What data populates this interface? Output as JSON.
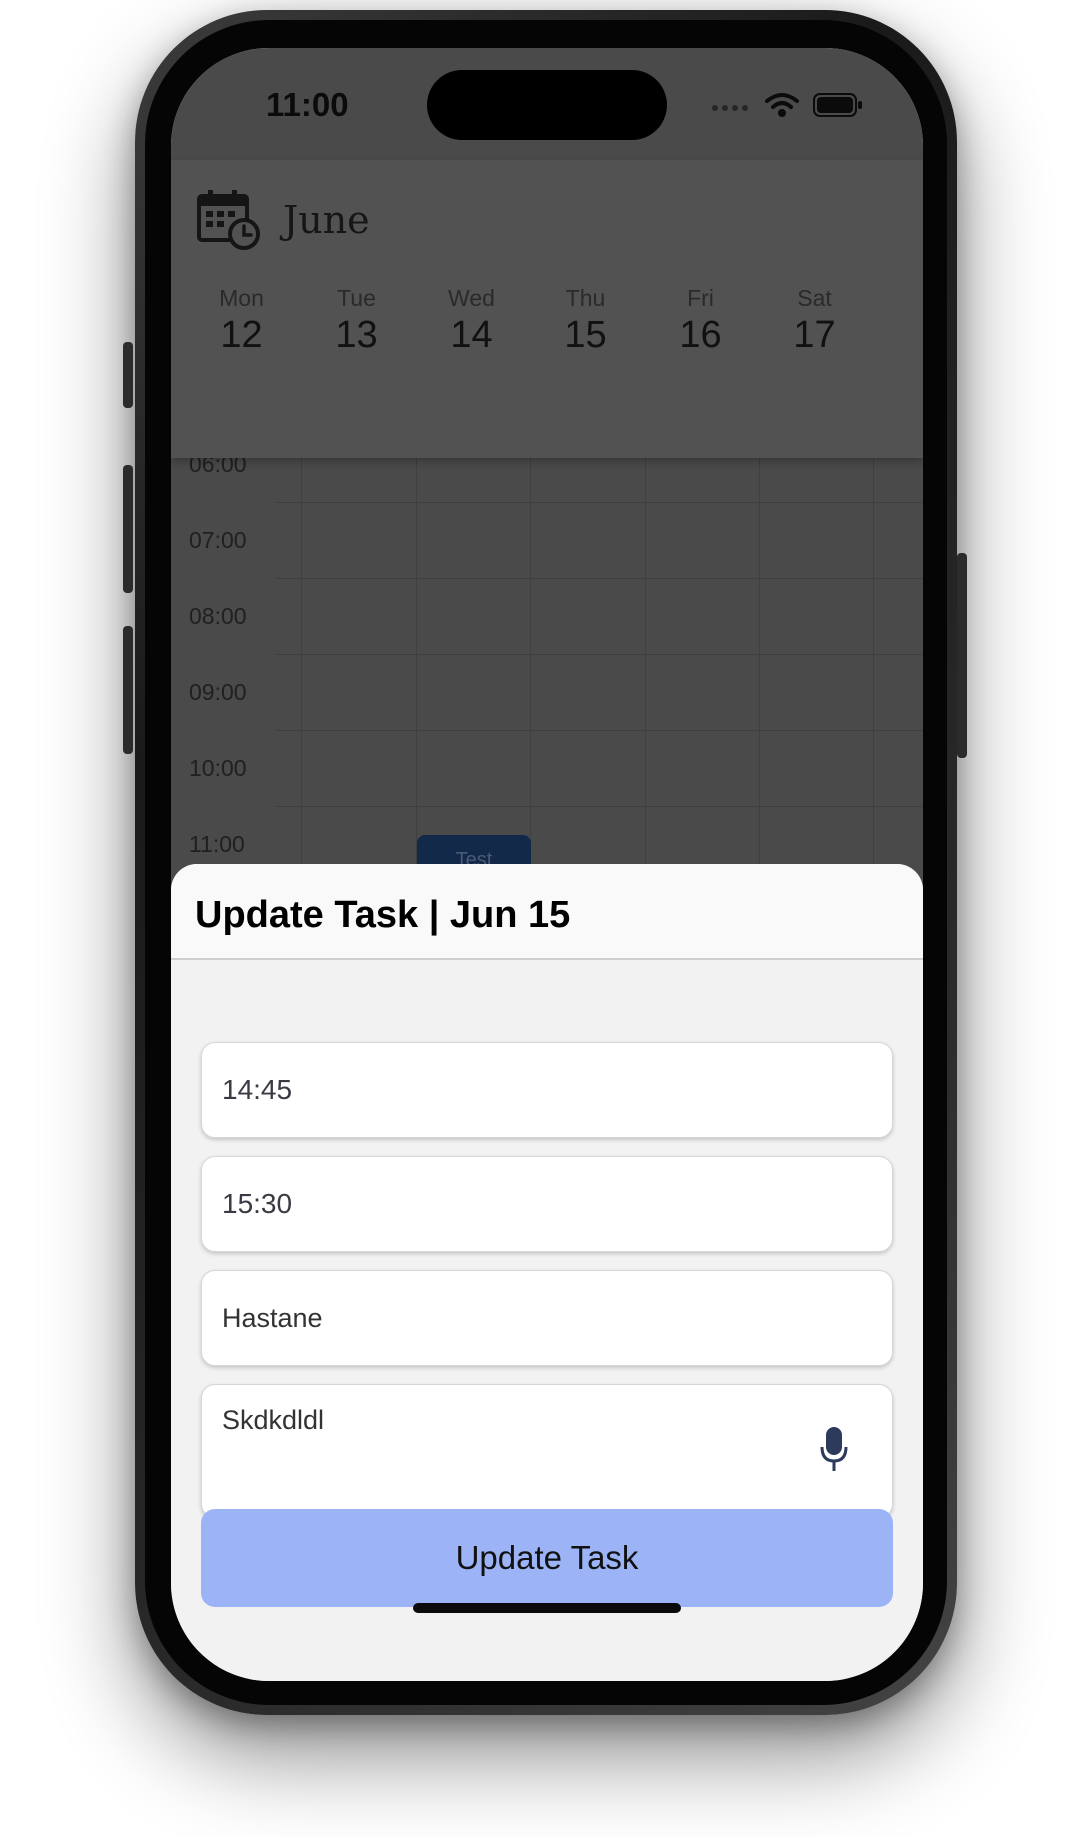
{
  "status_bar": {
    "time": "11:00"
  },
  "header": {
    "month": "June",
    "days": [
      {
        "name": "Mon",
        "number": "12"
      },
      {
        "name": "Tue",
        "number": "13"
      },
      {
        "name": "Wed",
        "number": "14"
      },
      {
        "name": "Thu",
        "number": "15"
      },
      {
        "name": "Fri",
        "number": "16"
      },
      {
        "name": "Sat",
        "number": "17"
      }
    ]
  },
  "schedule": {
    "hours": [
      "06:00",
      "07:00",
      "08:00",
      "09:00",
      "10:00",
      "11:00"
    ],
    "event_label": "Test"
  },
  "sheet": {
    "title": "Update Task | Jun 15",
    "start_time": "14:45",
    "end_time": "15:30",
    "task_title": "Hastane",
    "description": "Skdkdldl",
    "update_button_label": "Update Task"
  },
  "colors": {
    "button": "#9cb4f6",
    "event": "#12294a",
    "overlay": "#4a4a4a"
  }
}
